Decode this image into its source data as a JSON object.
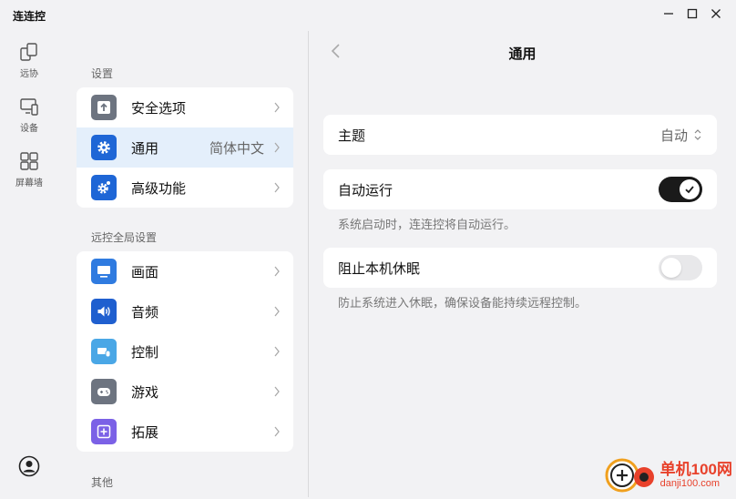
{
  "app": {
    "title": "连连控"
  },
  "window_controls": {
    "minimize": "minimize",
    "maximize": "maximize",
    "close": "close"
  },
  "rail": {
    "items": [
      {
        "label": "远协",
        "icon": "remote-assist-icon"
      },
      {
        "label": "设备",
        "icon": "device-icon"
      },
      {
        "label": "屏幕墙",
        "icon": "grid-icon"
      }
    ]
  },
  "settings": {
    "section_title": "设置",
    "items": [
      {
        "label": "安全选项",
        "value": "",
        "icon_color": "#6d7480"
      },
      {
        "label": "通用",
        "value": "简体中文",
        "icon_color": "#1e66d6",
        "active": true
      },
      {
        "label": "高级功能",
        "value": "",
        "icon_color": "#1e66d6"
      }
    ]
  },
  "remote_settings": {
    "section_title": "远控全局设置",
    "items": [
      {
        "label": "画面",
        "icon_color": "#2f7be0"
      },
      {
        "label": "音频",
        "icon_color": "#1f5fcf"
      },
      {
        "label": "控制",
        "icon_color": "#4aa7e6"
      },
      {
        "label": "游戏",
        "icon_color": "#6d7480"
      },
      {
        "label": "拓展",
        "icon_color": "#7b61e6"
      }
    ]
  },
  "other": {
    "section_title": "其他"
  },
  "detail": {
    "title": "通用",
    "theme": {
      "label": "主题",
      "value": "自动"
    },
    "auto_run": {
      "label": "自动运行",
      "desc": "系统启动时，连连控将自动运行。",
      "enabled": true
    },
    "prevent_sleep": {
      "label": "阻止本机休眠",
      "desc": "防止系统进入休眠，确保设备能持续远程控制。",
      "enabled": false
    }
  },
  "watermark": {
    "main": "单机100网",
    "sub": "danji100.com"
  }
}
